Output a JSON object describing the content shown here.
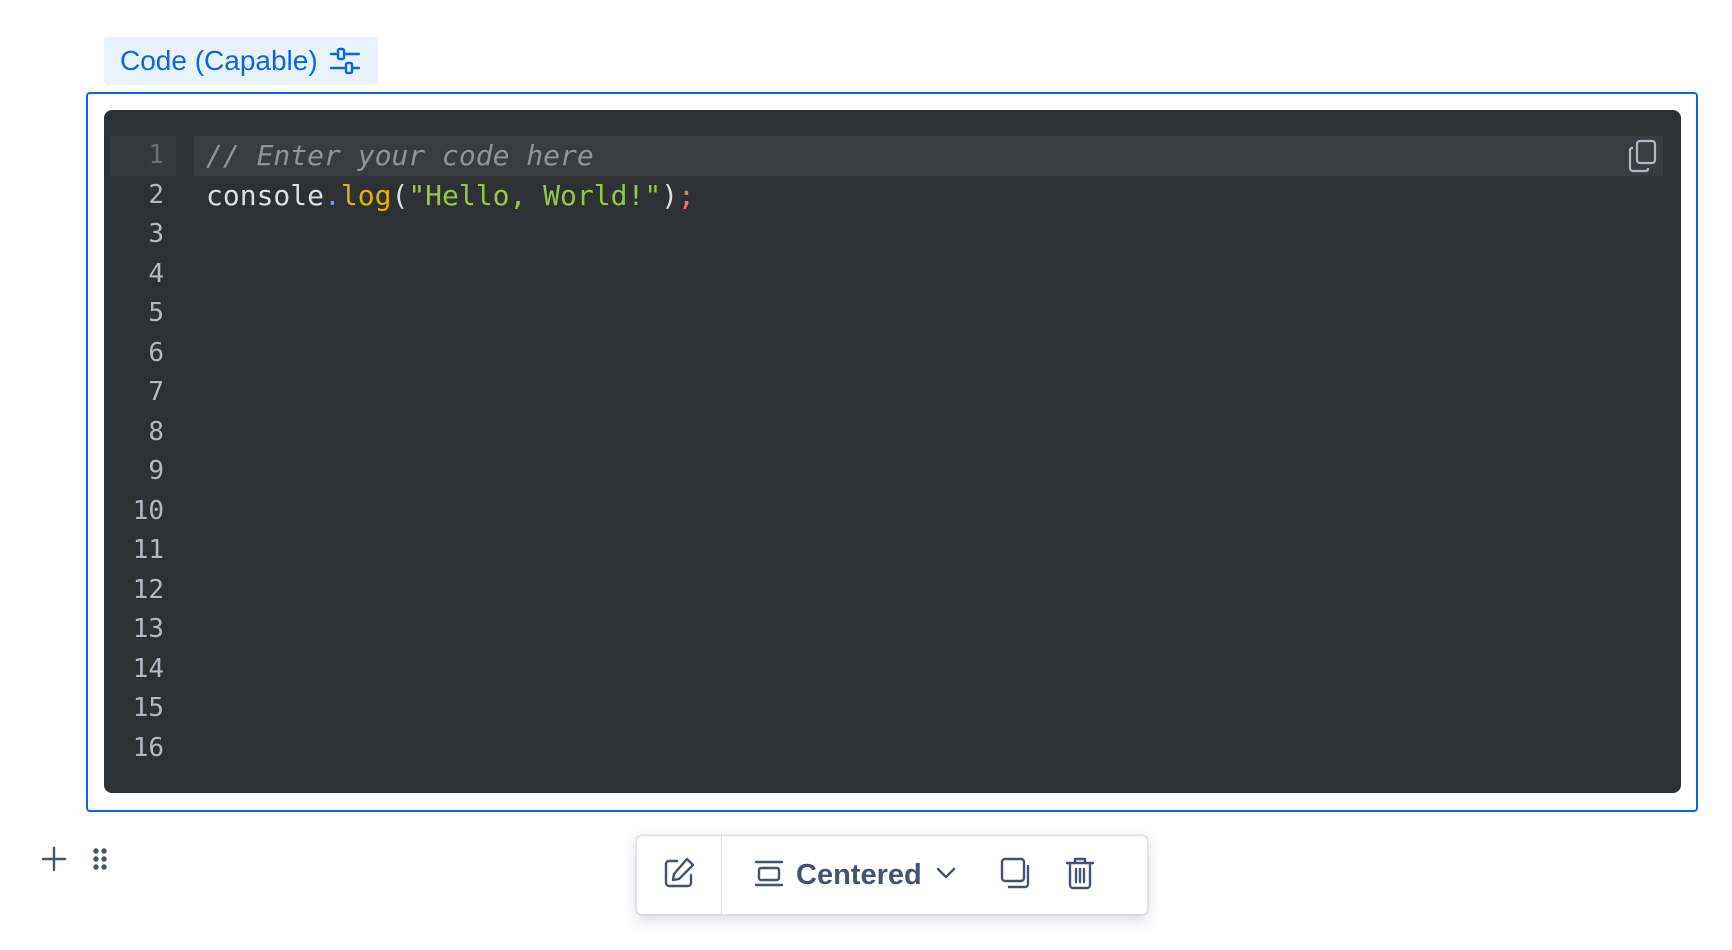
{
  "macro": {
    "label": "Code (Capable)",
    "settings_icon": "sliders-icon"
  },
  "editor": {
    "line_numbers": [
      "1",
      "2",
      "3",
      "4",
      "5",
      "6",
      "7",
      "8",
      "9",
      "10",
      "11",
      "12",
      "13",
      "14",
      "15",
      "16"
    ],
    "active_line": 1,
    "lines": {
      "line1": {
        "comment": "// Enter your code here"
      },
      "line2": {
        "obj": "console",
        "dot": ".",
        "func": "log",
        "paren_open": "(",
        "string": "\"Hello, World!\"",
        "paren_close": ")",
        "semi": ";"
      }
    },
    "copy_icon": "copy-icon",
    "colors": {
      "background": "#2e3134",
      "comment": "#8c939d",
      "function": "#e2b203",
      "string": "#94c748",
      "punctuation": "#579dff",
      "semicolon": "#f87168"
    }
  },
  "block_controls": {
    "add_icon": "plus-icon",
    "drag_icon": "drag-handle-icon"
  },
  "toolbar": {
    "edit_icon": "edit-icon",
    "layout_icon": "layout-centered-icon",
    "layout_label": "Centered",
    "dropdown_icon": "chevron-down-icon",
    "copy_icon": "copy-icon",
    "delete_icon": "trash-icon"
  },
  "colors": {
    "accent": "#0c66e4",
    "label_background": "#e9f2ff"
  }
}
